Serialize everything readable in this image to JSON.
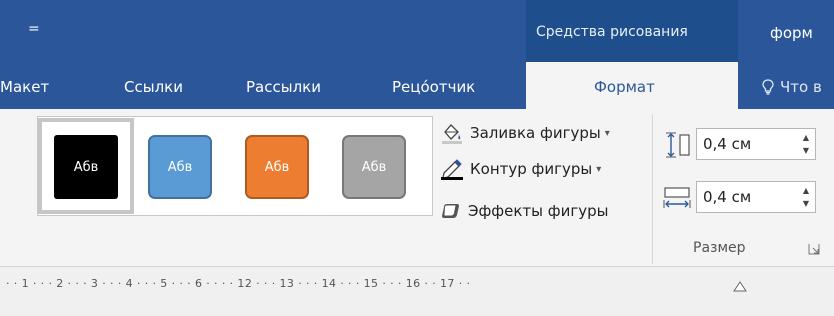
{
  "title_bar": {
    "qat_glyph": "=",
    "context_group_label": "Средства рисования",
    "context_tab_label": "форм"
  },
  "tabs": [
    {
      "label": "Макет"
    },
    {
      "label": "Ссылки"
    },
    {
      "label": "Рассылки"
    },
    {
      "label": "Рецо́отчик"
    }
  ],
  "active_tab": {
    "label": "Формат"
  },
  "tell_me": {
    "label": "Что в"
  },
  "shape_styles": {
    "swatches": [
      {
        "label": "Абв",
        "color": "#000000",
        "selected": true
      },
      {
        "label": "Абв",
        "color": "#5b9bd5",
        "selected": false
      },
      {
        "label": "Абв",
        "color": "#ed7d31",
        "selected": false
      },
      {
        "label": "Абв",
        "color": "#a5a5a5",
        "selected": false
      }
    ],
    "commands": {
      "fill": "Заливка фигуры",
      "outline": "Контур фигуры",
      "effects": "Эффекты фигуры"
    }
  },
  "size": {
    "height_value": "0,4 см",
    "width_value": "0,4 см",
    "group_label": "Размер"
  },
  "ruler": {
    "text": "· · 1 · · · 2 · · · 3 · · · 4 · · · 5 · · · 6 · · · · 12 · · · 13 · · · 14 · · · 15 · · · 16 · · 17 · ·"
  }
}
